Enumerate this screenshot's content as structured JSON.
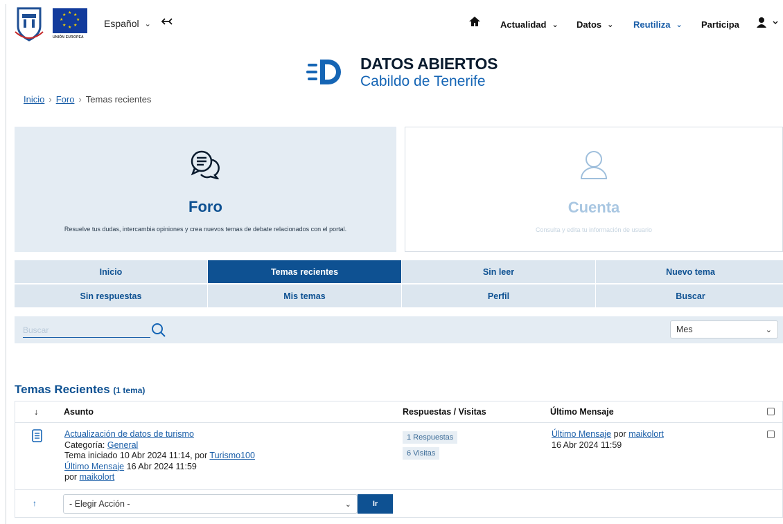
{
  "header": {
    "eu_label": "UNIÓN EUROPEA",
    "language": "Español",
    "nav": [
      {
        "label": "Actualidad"
      },
      {
        "label": "Datos"
      },
      {
        "label": "Reutiliza"
      },
      {
        "label": "Participa"
      }
    ]
  },
  "brand": {
    "title": "DATOS ABIERTOS",
    "subtitle": "Cabildo de Tenerife"
  },
  "breadcrumb": [
    "Inicio",
    "Foro",
    "Temas recientes"
  ],
  "cards": {
    "foro": {
      "title": "Foro",
      "desc": "Resuelve tus dudas, intercambia opiniones y crea nuevos temas de debate relacionados con el portal."
    },
    "cuenta": {
      "title": "Cuenta",
      "desc": "Consulta y edita tu información de usuario"
    }
  },
  "tabs": [
    {
      "label": "Inicio"
    },
    {
      "label": "Temas recientes"
    },
    {
      "label": "Sin leer"
    },
    {
      "label": "Nuevo tema"
    },
    {
      "label": "Sin respuestas"
    },
    {
      "label": "Mis temas"
    },
    {
      "label": "Perfil"
    },
    {
      "label": "Buscar"
    }
  ],
  "search": {
    "placeholder": "Buscar",
    "period": "Mes"
  },
  "recent": {
    "title": "Temas Recientes",
    "count": "(1 tema)",
    "columns": {
      "subject": "Asunto",
      "stats": "Respuestas / Visitas",
      "last": "Último Mensaje"
    },
    "topics": [
      {
        "title": "Actualización de datos de turismo",
        "category_label": "Categoría:",
        "category": "General",
        "started_text": "Tema iniciado 10 Abr 2024 11:14, por",
        "started_by": "Turismo100",
        "last_link": "Último Mensaje",
        "last_date": "16 Abr 2024 11:59",
        "by_label": "por",
        "last_by": "maikolort",
        "replies": "1 Respuestas",
        "views": "6 Visitas",
        "last_col_link": "Último Mensaje",
        "last_col_by_label": "por",
        "last_col_by": "maikolort",
        "last_col_date": "16 Abr 2024 11:59"
      }
    ],
    "action_placeholder": "- Elegir Acción -",
    "go_label": "Ir"
  }
}
